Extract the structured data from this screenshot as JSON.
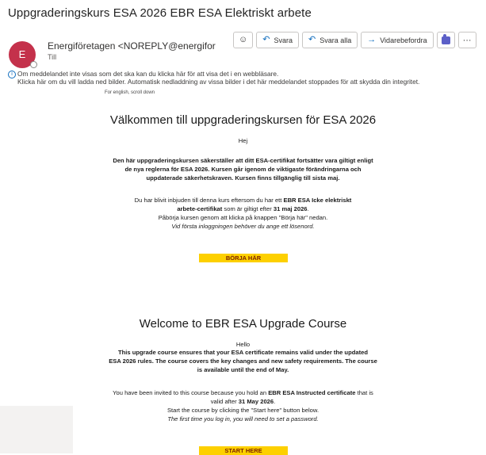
{
  "email": {
    "subject": "Uppgraderingskurs ESA 2026  EBR ESA Elektriskt arbete",
    "avatar_initial": "E",
    "sender": "Energiföretagen <NOREPLY@energiforet",
    "to_label": "Till",
    "info_line1": "Om meddelandet inte visas som det ska kan du klicka här för att visa det i en webbläsare.",
    "info_line2": "Klicka här om du vill ladda ned bilder. Automatisk nedladdning av vissa bilder i det här meddelandet stoppades för att skydda din integritet."
  },
  "toolbar": {
    "emoji_icon": "smile-icon",
    "reply": "Svara",
    "reply_all": "Svara alla",
    "forward": "Vidarebefordra",
    "more": "···"
  },
  "swedish": {
    "english_link": "For english, scroll down",
    "heading": "Välkommen till uppgraderingskursen för ESA 2026",
    "greeting": "Hej",
    "p1_l1": "Den här uppgraderingskursen säkerställer att ditt ESA-certifikat fortsätter vara giltigt enligt",
    "p1_l2": "de nya reglerna för ESA 2026. Kursen går igenom de viktigaste förändringarna och",
    "p1_l3": "uppdaterade säkerhetskraven. Kursen finns tillgänglig till sista maj.",
    "p2_l1_a": "Du har blivit inbjuden till denna kurs eftersom du har ett ",
    "p2_l1_b": "EBR ESA Icke elektriskt",
    "p2_l2_b": "arbete-certifikat",
    "p2_l2_c": " som är giltigt efter ",
    "p2_l2_d": "31 maj 2026",
    "p2_l2_e": ".",
    "p2_l3": "Påbörja kursen genom att klicka på knappen \"Börja här\" nedan.",
    "p2_l4": "Vid första inloggningen behöver du ange ett lösenord.",
    "cta": "BÖRJA HÄR"
  },
  "english": {
    "heading": "Welcome to EBR ESA Upgrade Course",
    "greeting": "Hello",
    "p1_l1": "This upgrade course ensures that your ESA certificate remains valid under the updated",
    "p1_l2": "ESA 2026 rules. The course covers the key changes and new safety requirements. The course",
    "p1_l3": "is available until the end of May.",
    "p2_l1_a": "You have been invited to this course because you hold an ",
    "p2_l1_b": "EBR ESA Instructed certificate",
    "p2_l1_c": " that is",
    "p2_l2_a": "valid after ",
    "p2_l2_b": "31 May 2026",
    "p2_l2_c": ".",
    "p2_l3": "Start the course by clicking the \"Start here\" button below.",
    "p2_l4": "The first time you log in, you will need to set a password.",
    "cta": "START HERE"
  }
}
